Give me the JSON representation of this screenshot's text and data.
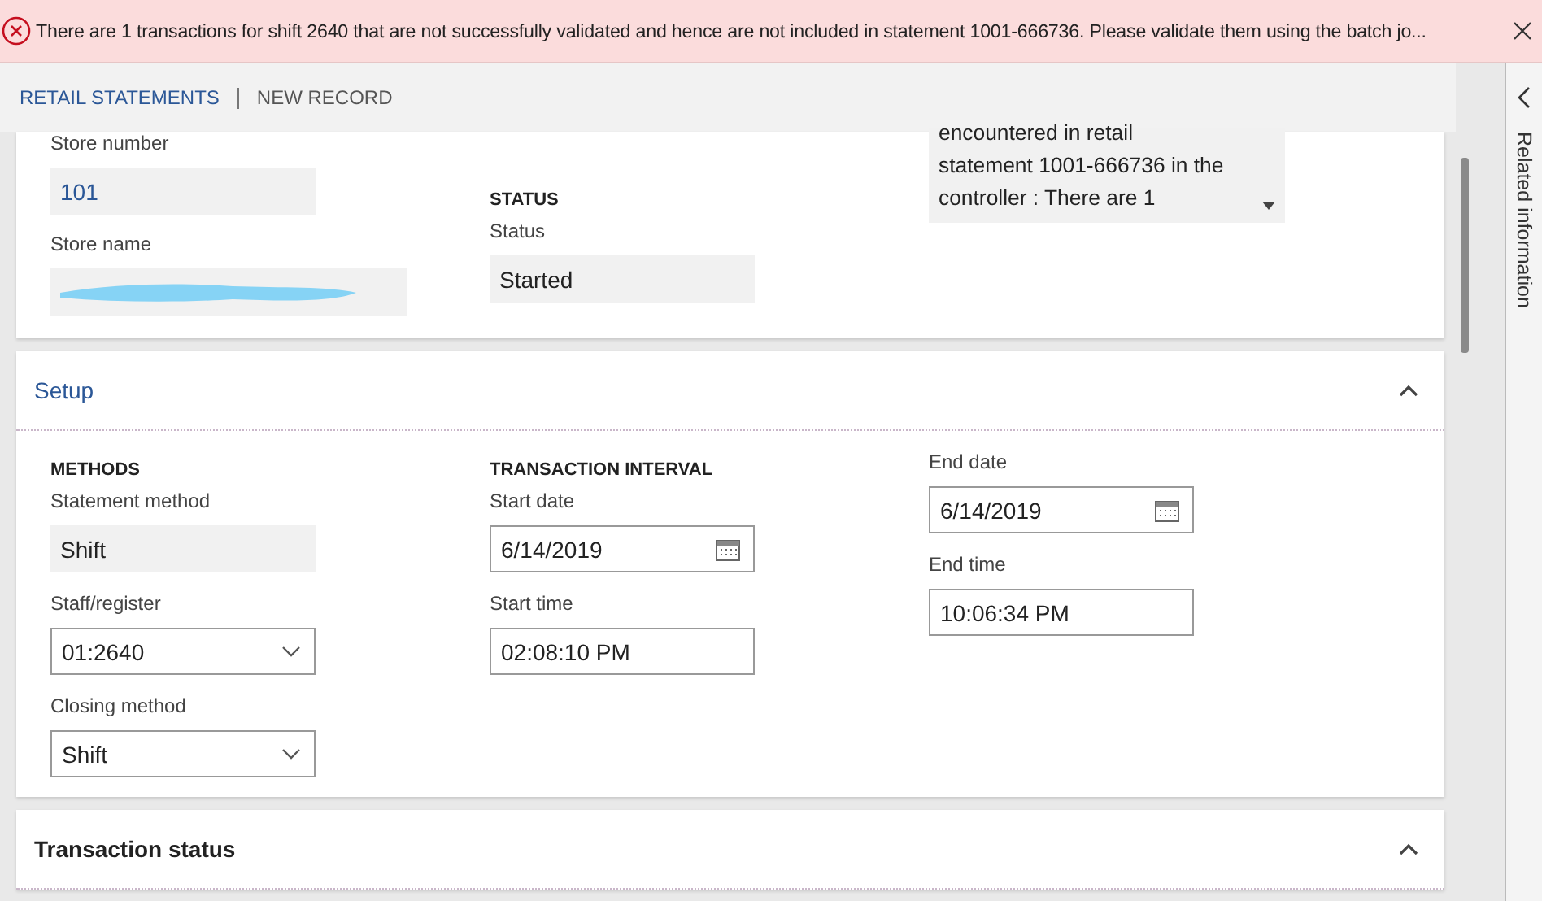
{
  "banner": {
    "message": "There are 1 transactions for shift 2640 that are not successfully validated and hence are not included in statement 1001-666736. Please validate them using the batch jo..."
  },
  "breadcrumbs": [
    {
      "label": "RETAIL STATEMENTS",
      "kind": "link"
    },
    {
      "label": "NEW RECORD",
      "kind": "current"
    }
  ],
  "header_card": {
    "columns": [
      {
        "fields": [
          {
            "label": "Store number",
            "kind": "readonly-link",
            "value": "101"
          },
          {
            "label": "Store name",
            "kind": "redacted"
          }
        ]
      },
      {
        "heading": "STATUS",
        "fields": [
          {
            "label": "Status",
            "kind": "readonly",
            "value": "Started"
          }
        ]
      }
    ],
    "message_box": {
      "lines": [
        "encountered in retail",
        "statement 1001-666736 in the",
        "controller : There are 1"
      ]
    }
  },
  "sections": [
    {
      "title": "Setup",
      "expanded": true,
      "columns": [
        {
          "heading": "METHODS",
          "fields": [
            {
              "label": "Statement method",
              "kind": "readonly",
              "value": "Shift"
            },
            {
              "label": "Staff/register",
              "kind": "dropdown",
              "value": "01:2640"
            },
            {
              "label": "Closing method",
              "kind": "dropdown",
              "value": "Shift"
            }
          ]
        },
        {
          "heading": "TRANSACTION INTERVAL",
          "fields": [
            {
              "label": "Start date",
              "kind": "date",
              "value": "6/14/2019"
            },
            {
              "label": "Start time",
              "kind": "text",
              "value": "02:08:10 PM"
            }
          ]
        },
        {
          "fields": [
            {
              "label": "End date",
              "kind": "date",
              "value": "6/14/2019"
            },
            {
              "label": "End time",
              "kind": "text",
              "value": "10:06:34 PM"
            }
          ]
        }
      ]
    },
    {
      "title": "Transaction status",
      "expanded": true
    }
  ],
  "side_panel": {
    "label": "Related information"
  }
}
